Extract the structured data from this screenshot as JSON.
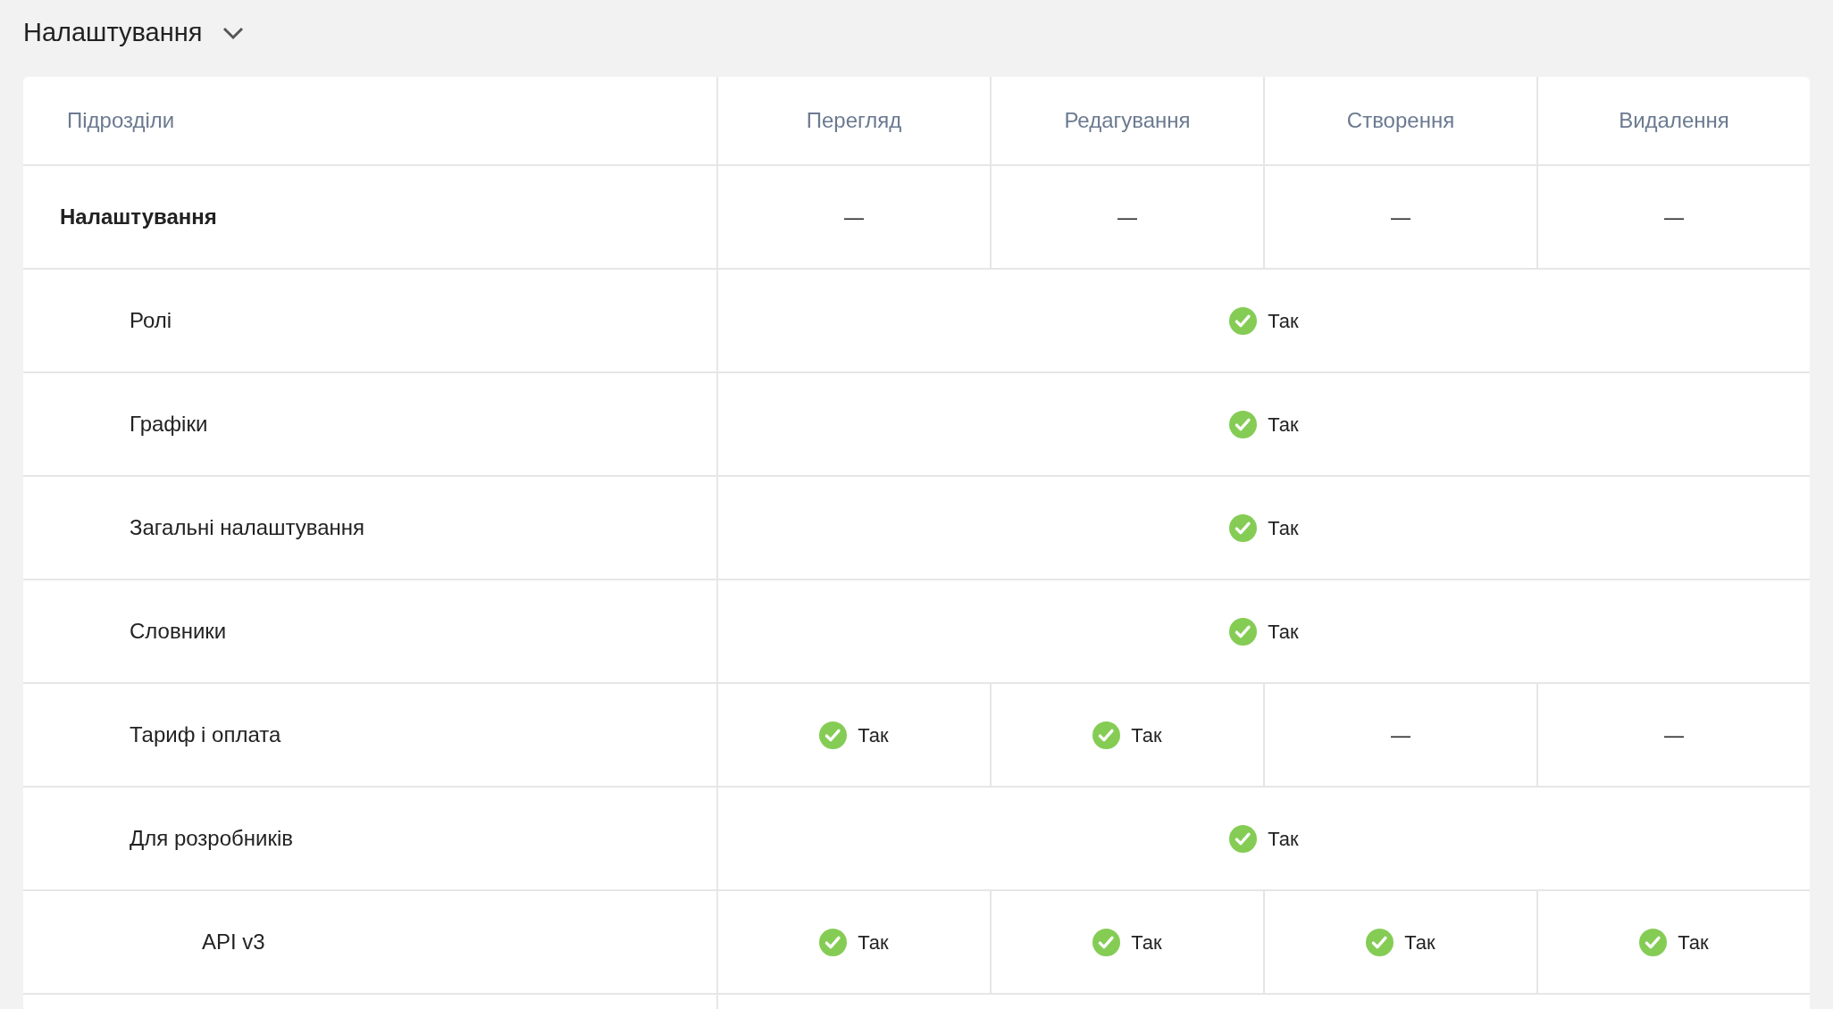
{
  "section": {
    "title": "Налаштування"
  },
  "table": {
    "columns": [
      "Підрозділи",
      "Перегляд",
      "Редагування",
      "Створення",
      "Видалення"
    ],
    "rows": [
      {
        "bold": true,
        "cells": [
          {
            "kind": "name",
            "text": "Налаштування"
          },
          {
            "kind": "dash",
            "text": "—"
          },
          {
            "kind": "dash",
            "text": "—"
          },
          {
            "kind": "dash",
            "text": "—"
          },
          {
            "kind": "dash",
            "text": "—"
          }
        ],
        "children": [
          {
            "bold": false,
            "cells": [
              {
                "kind": "name",
                "text": "Ролі"
              },
              {
                "kind": "yes",
                "text": "Так",
                "merged": true
              }
            ]
          },
          {
            "bold": false,
            "cells": [
              {
                "kind": "name",
                "text": "Графіки"
              },
              {
                "kind": "yes",
                "text": "Так",
                "merged": true
              }
            ]
          },
          {
            "bold": false,
            "cells": [
              {
                "kind": "name",
                "text": "Загальні налаштування"
              },
              {
                "kind": "yes",
                "text": "Так",
                "merged": true
              }
            ]
          },
          {
            "bold": false,
            "cells": [
              {
                "kind": "name",
                "text": "Словники"
              },
              {
                "kind": "yes",
                "text": "Так",
                "merged": true
              }
            ]
          },
          {
            "bold": false,
            "cells": [
              {
                "kind": "name",
                "text": "Тариф і оплата"
              },
              {
                "kind": "yes",
                "text": "Так"
              },
              {
                "kind": "yes",
                "text": "Так"
              },
              {
                "kind": "dash",
                "text": "—"
              },
              {
                "kind": "dash",
                "text": "—"
              }
            ]
          },
          {
            "bold": false,
            "cells": [
              {
                "kind": "name",
                "text": "Для розробників"
              },
              {
                "kind": "yes",
                "text": "Так",
                "merged": true
              }
            ],
            "children": [
              {
                "bold": false,
                "cells": [
                  {
                    "kind": "name",
                    "text": "API v3"
                  },
                  {
                    "kind": "yes",
                    "text": "Так"
                  },
                  {
                    "kind": "yes",
                    "text": "Так"
                  },
                  {
                    "kind": "yes",
                    "text": "Так"
                  },
                  {
                    "kind": "yes",
                    "text": "Так"
                  }
                ]
              }
            ]
          }
        ]
      }
    ]
  }
}
